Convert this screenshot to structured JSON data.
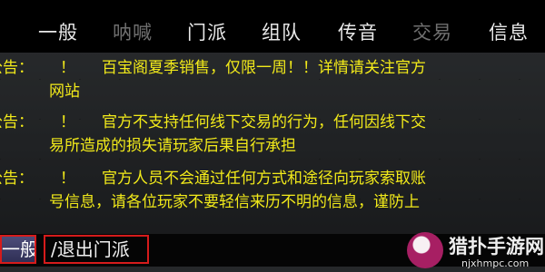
{
  "tabs": [
    {
      "label": "一般",
      "enabled": true
    },
    {
      "label": "呐喊",
      "enabled": false
    },
    {
      "label": "门派",
      "enabled": true
    },
    {
      "label": "组队",
      "enabled": true
    },
    {
      "label": "传音",
      "enabled": true
    },
    {
      "label": "交易",
      "enabled": false
    },
    {
      "label": "信息",
      "enabled": true
    }
  ],
  "announcements": [
    {
      "prefix": "公告：",
      "mark": "！",
      "line1": "百宝阁夏季销售，仅限一周！！详情请关注官方",
      "line2": "网站"
    },
    {
      "prefix": "公告：",
      "mark": "！",
      "line1": "官方不支持任何线下交易的行为，任何因线下交",
      "line2": "易所造成的损失请玩家后果自行承担"
    },
    {
      "prefix": "公告：",
      "mark": "！",
      "line1": "官方人员不会通过任何方式和途径向玩家索取账",
      "line2": "号信息，请各位玩家不要轻信来历不明的信息，谨防上"
    }
  ],
  "input": {
    "channel": "一般",
    "command": "/退出门派"
  },
  "watermark": {
    "title": "猎扑手游网",
    "url": "njxhmpc.com"
  },
  "colors": {
    "announcement_text": "#f2ea1a",
    "highlight_border": "#d61b1b",
    "tab_bar": "#000000"
  }
}
